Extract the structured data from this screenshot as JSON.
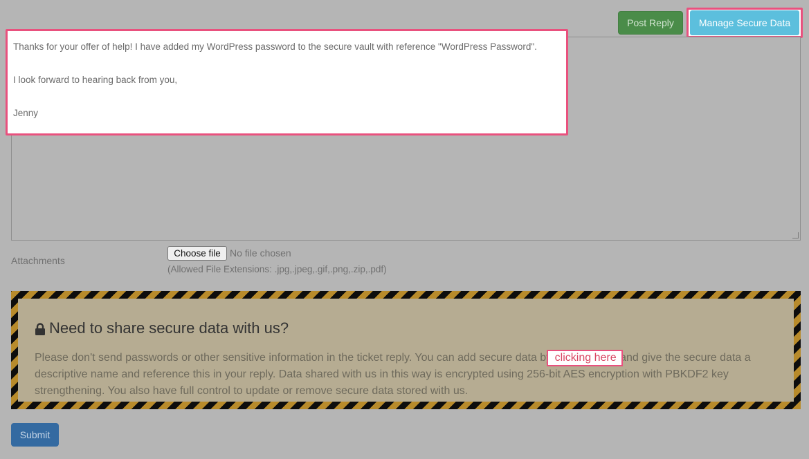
{
  "actions": {
    "post_reply_label": "Post Reply",
    "manage_secure_label": "Manage Secure Data"
  },
  "reply": {
    "line1": "Thanks for your offer of help! I have added my WordPress password to the secure vault with reference \"WordPress Password\".",
    "line2": "I look forward to hearing back from you,",
    "line3": "Jenny"
  },
  "attachments": {
    "label": "Attachments",
    "choose_file_label": "Choose file",
    "no_file_text": "No file chosen",
    "allowed_text": "(Allowed File Extensions: .jpg,.jpeg,.gif,.png,.zip,.pdf)"
  },
  "secure_notice": {
    "icon": "lock-icon",
    "title": "Need to share secure data with us?",
    "text_before_link": "Please don't send passwords or other sensitive information in the ticket reply. You can add secure data by",
    "link_text": "clicking here",
    "text_after_link": "and give the secure data a descriptive name and reference this in your reply. Data shared with us in this way is encrypted using 256-bit AES encryption with PBKDF2 key strengthening. You also have full control to update or remove secure data stored with us."
  },
  "submit_label": "Submit",
  "colors": {
    "highlight": "#e9517e",
    "post_reply": "#4a8c49",
    "manage_secure": "#5cbfdd",
    "submit": "#346aa1",
    "hazard_stripe_gold": "#b88b2b",
    "hazard_stripe_black": "#0d0d0d"
  }
}
